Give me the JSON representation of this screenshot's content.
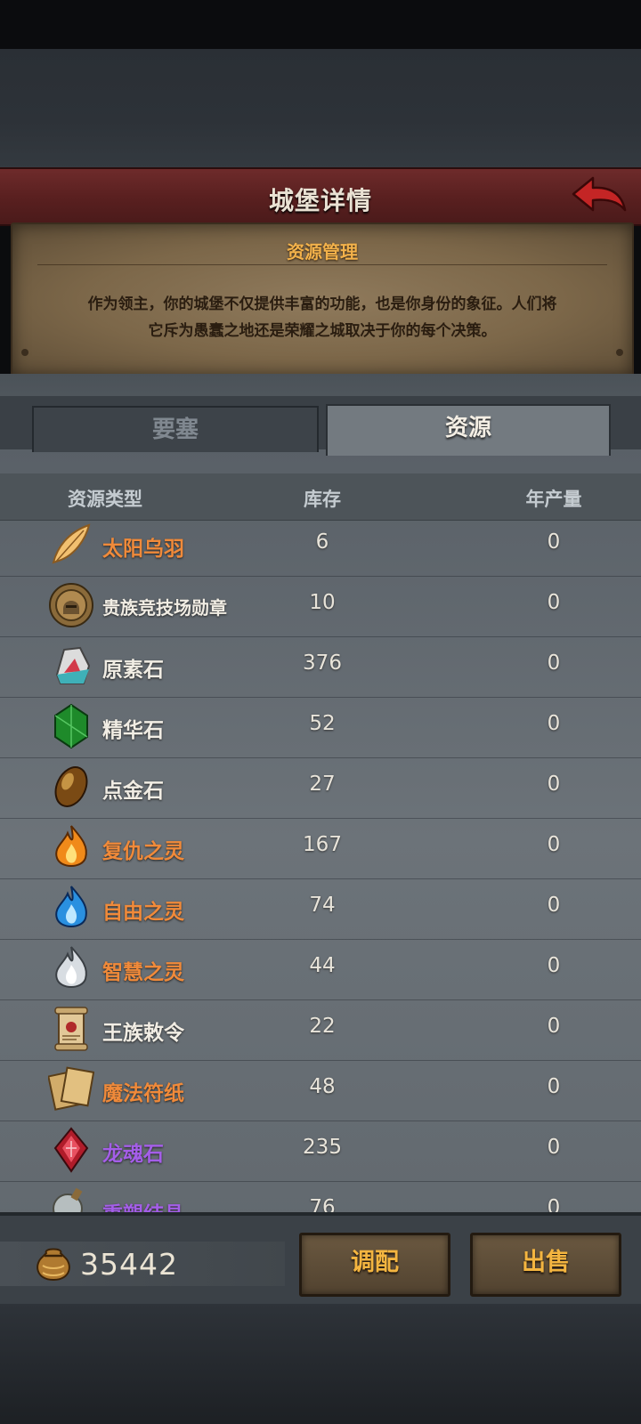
{
  "header": {
    "title": "城堡详情"
  },
  "info": {
    "heading": "资源管理",
    "description_line1": "作为领主，你的城堡不仅提供丰富的功能，也是你身份的象征。人们将",
    "description_line2": "它斥为愚蠢之地还是荣耀之城取决于你的每个决策。"
  },
  "tabs": [
    {
      "label": "要塞",
      "active": false
    },
    {
      "label": "资源",
      "active": true
    }
  ],
  "table": {
    "headers": {
      "type": "资源类型",
      "stock": "库存",
      "yearly": "年产量"
    },
    "rows": [
      {
        "name": "太阳乌羽",
        "stock": "6",
        "yearly": "0",
        "icon": "feather-icon",
        "color": "#f08a3a"
      },
      {
        "name": "贵族竞技场勋章",
        "stock": "10",
        "yearly": "0",
        "icon": "medal-icon",
        "color": "#f1ede4"
      },
      {
        "name": "原素石",
        "stock": "376",
        "yearly": "0",
        "icon": "elemental-stone-icon",
        "color": "#f1ede4"
      },
      {
        "name": "精华石",
        "stock": "52",
        "yearly": "0",
        "icon": "green-gem-icon",
        "color": "#f1ede4"
      },
      {
        "name": "点金石",
        "stock": "27",
        "yearly": "0",
        "icon": "golden-stone-icon",
        "color": "#f1ede4"
      },
      {
        "name": "复仇之灵",
        "stock": "167",
        "yearly": "0",
        "icon": "orange-flame-icon",
        "color": "#f08a3a"
      },
      {
        "name": "自由之灵",
        "stock": "74",
        "yearly": "0",
        "icon": "blue-flame-icon",
        "color": "#f08a3a"
      },
      {
        "name": "智慧之灵",
        "stock": "44",
        "yearly": "0",
        "icon": "white-flame-icon",
        "color": "#f08a3a"
      },
      {
        "name": "王族敕令",
        "stock": "22",
        "yearly": "0",
        "icon": "scroll-icon",
        "color": "#f1ede4"
      },
      {
        "name": "魔法符纸",
        "stock": "48",
        "yearly": "0",
        "icon": "parchment-icon",
        "color": "#f08a3a"
      },
      {
        "name": "龙魂石",
        "stock": "235",
        "yearly": "0",
        "icon": "red-crystal-icon",
        "color": "#a45ee8"
      },
      {
        "name": "重塑结晶",
        "stock": "76",
        "yearly": "0",
        "icon": "potion-gold-icon",
        "color": "#a45ee8"
      }
    ]
  },
  "footer": {
    "gold": "35442",
    "gold_icon": "gold-sack-icon",
    "allocate_label": "调配",
    "sell_label": "出售"
  },
  "colors": {
    "accent_gold": "#f4b540",
    "title_bar": "#5a2020",
    "back_arrow": "#c42525"
  }
}
